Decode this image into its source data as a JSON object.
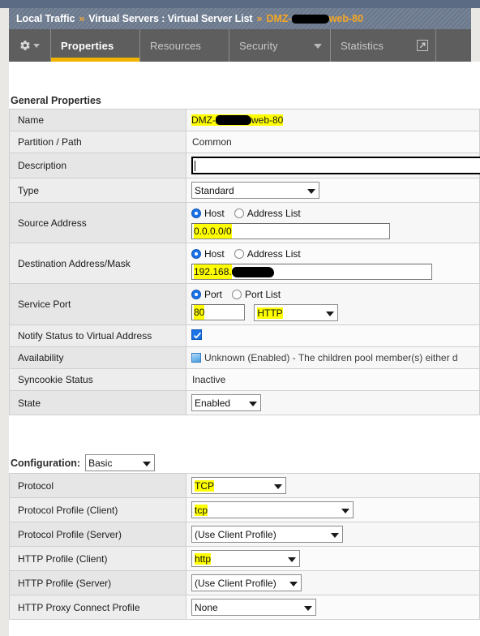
{
  "breadcrumb": {
    "root": "Local Traffic",
    "sep": "»",
    "section": "Virtual Servers : Virtual Server List",
    "current_prefix": "DMZ-",
    "current_suffix": "web-80"
  },
  "tabs": {
    "gear_icon": "gear-icon",
    "items": [
      {
        "label": "Properties",
        "active": true
      },
      {
        "label": "Resources",
        "active": false
      },
      {
        "label": "Security",
        "active": false,
        "has_caret": true
      },
      {
        "label": "Statistics",
        "active": false,
        "has_popout": true
      }
    ]
  },
  "general_properties": {
    "title": "General Properties",
    "rows": {
      "name": {
        "label": "Name",
        "value_prefix": "DMZ-",
        "value_suffix": "web-80",
        "highlighted": true
      },
      "partition": {
        "label": "Partition / Path",
        "value": "Common"
      },
      "description": {
        "label": "Description",
        "value": "",
        "focused": true
      },
      "type": {
        "label": "Type",
        "value": "Standard"
      },
      "source_address": {
        "label": "Source Address",
        "radio_host": "Host",
        "radio_list": "Address List",
        "selected": "Host",
        "value": "0.0.0.0/0",
        "highlighted": true
      },
      "destination_address": {
        "label": "Destination Address/Mask",
        "radio_host": "Host",
        "radio_list": "Address List",
        "selected": "Host",
        "value": "192.168.",
        "highlighted": true
      },
      "service_port": {
        "label": "Service Port",
        "radio_port": "Port",
        "radio_port_list": "Port List",
        "selected": "Port",
        "port_value": "80",
        "service_value": "HTTP",
        "highlighted": true
      },
      "notify_status": {
        "label": "Notify Status to Virtual Address",
        "checked": true
      },
      "availability": {
        "label": "Availability",
        "status_icon": "status-unknown-icon",
        "value": "Unknown (Enabled) - The children pool member(s) either d"
      },
      "syncookie": {
        "label": "Syncookie Status",
        "value": "Inactive"
      },
      "state": {
        "label": "State",
        "value": "Enabled"
      }
    }
  },
  "configuration": {
    "label": "Configuration:",
    "mode": "Basic",
    "rows": {
      "protocol": {
        "label": "Protocol",
        "value": "TCP",
        "highlighted": true
      },
      "protocol_profile_client": {
        "label": "Protocol Profile (Client)",
        "value": "tcp",
        "highlighted": true
      },
      "protocol_profile_server": {
        "label": "Protocol Profile (Server)",
        "value": "(Use Client Profile)",
        "highlighted": false
      },
      "http_profile_client": {
        "label": "HTTP Profile (Client)",
        "value": "http",
        "highlighted": true
      },
      "http_profile_server": {
        "label": "HTTP Profile (Server)",
        "value": "(Use Client Profile)",
        "highlighted": false
      },
      "http_proxy_connect_profile": {
        "label": "HTTP Proxy Connect Profile",
        "value": "None",
        "highlighted": false
      }
    }
  },
  "colors": {
    "breadcrumb_bg": "#6f7d92",
    "tabbar_bg": "#5e5e5e",
    "accent_yellow": "#f0b400",
    "highlight": "#ffff00",
    "crumb_current": "#f5a623",
    "radio_blue": "#1a73e8"
  }
}
